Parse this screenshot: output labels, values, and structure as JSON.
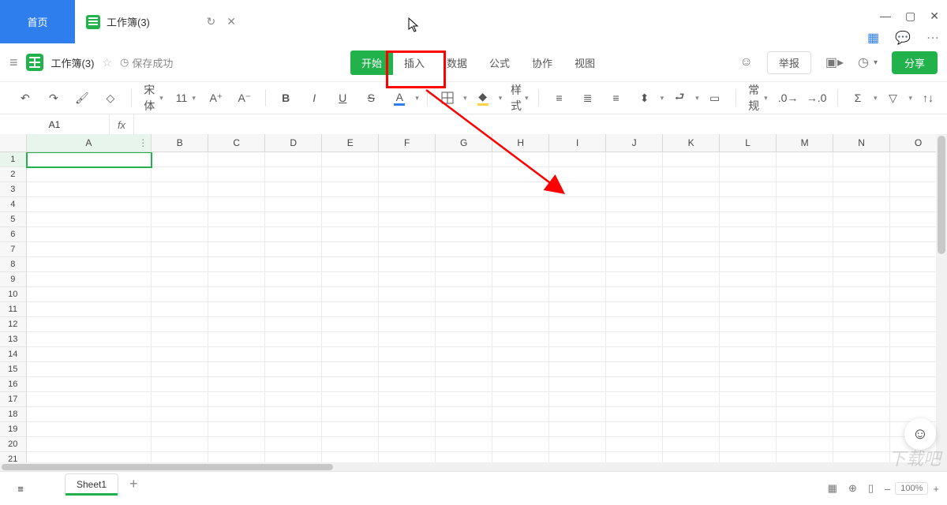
{
  "titlebar": {
    "home_label": "首页",
    "doc_tab_label": "工作簿(3)"
  },
  "docheader": {
    "title": "工作簿(3)",
    "save_status": "保存成功",
    "menus": [
      "开始",
      "插入",
      "数据",
      "公式",
      "协作",
      "视图"
    ],
    "report_label": "举报",
    "share_label": "分享"
  },
  "toolbar": {
    "font_name": "宋体",
    "font_size": "11",
    "cell_style_label": "样式",
    "number_format_label": "常规"
  },
  "formula": {
    "namebox": "A1",
    "fx": "fx",
    "value": ""
  },
  "grid": {
    "columns": [
      "A",
      "B",
      "C",
      "D",
      "E",
      "F",
      "G",
      "H",
      "I",
      "J",
      "K",
      "L",
      "M",
      "N",
      "O"
    ],
    "row_count": 21,
    "active_cell": "A1"
  },
  "sheets": {
    "tabs": [
      "Sheet1"
    ],
    "active": "Sheet1"
  },
  "statusbar": {
    "zoom": "100%"
  }
}
